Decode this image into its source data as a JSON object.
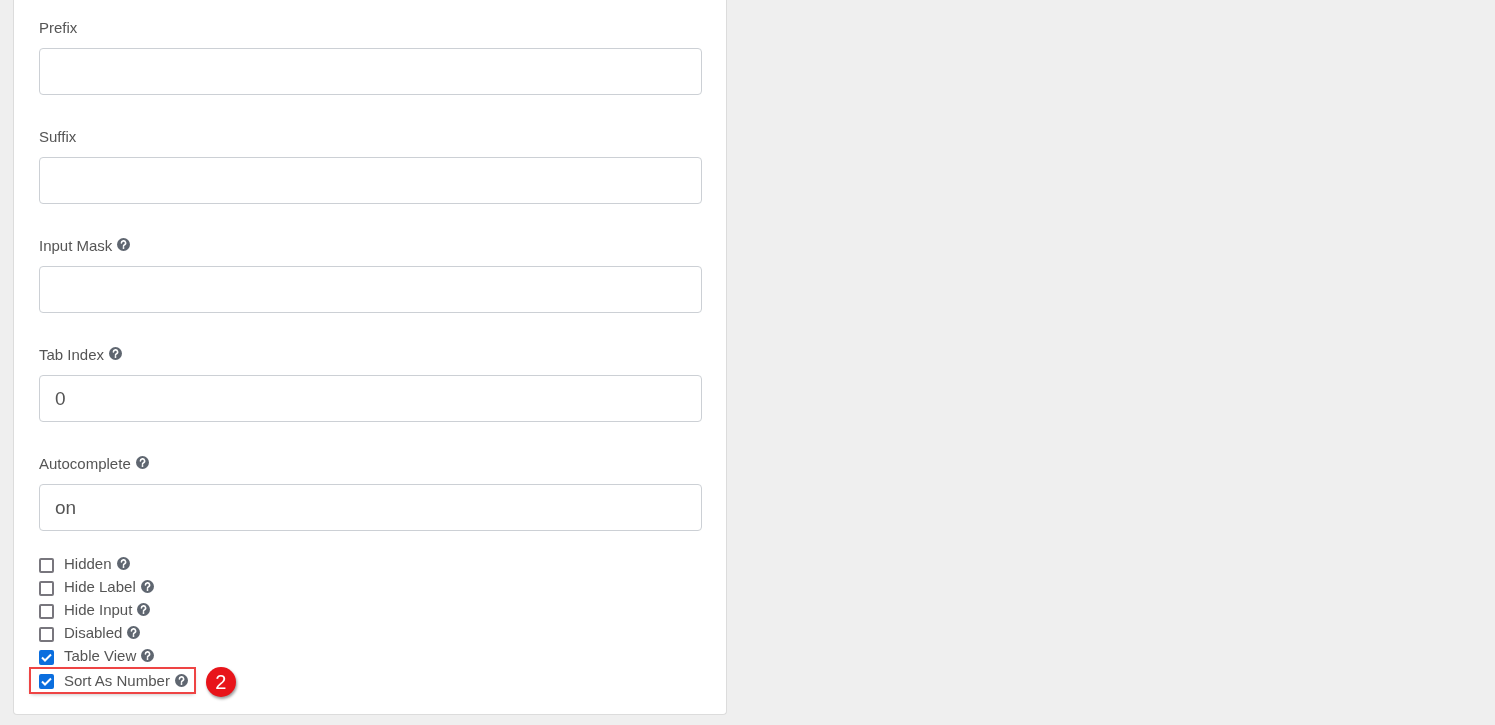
{
  "fields": [
    {
      "label": "Prefix",
      "help": false
    },
    {
      "label": "Suffix",
      "help": false
    },
    {
      "label": "Input Mask",
      "help": true
    },
    {
      "label": "Tab Index",
      "help": true,
      "value": "0"
    },
    {
      "label": "Autocomplete",
      "help": true,
      "value": "on"
    }
  ],
  "checkboxes": [
    {
      "label": "Hidden",
      "checked": false,
      "help": true,
      "highlighted": false
    },
    {
      "label": "Hide Label",
      "checked": false,
      "help": true,
      "highlighted": false
    },
    {
      "label": "Hide Input",
      "checked": false,
      "help": true,
      "highlighted": false
    },
    {
      "label": "Disabled",
      "checked": false,
      "help": true,
      "highlighted": false
    },
    {
      "label": "Table View",
      "checked": true,
      "help": true,
      "highlighted": false
    },
    {
      "label": "Sort As Number",
      "checked": true,
      "help": true,
      "highlighted": true,
      "badge": "2"
    }
  ]
}
